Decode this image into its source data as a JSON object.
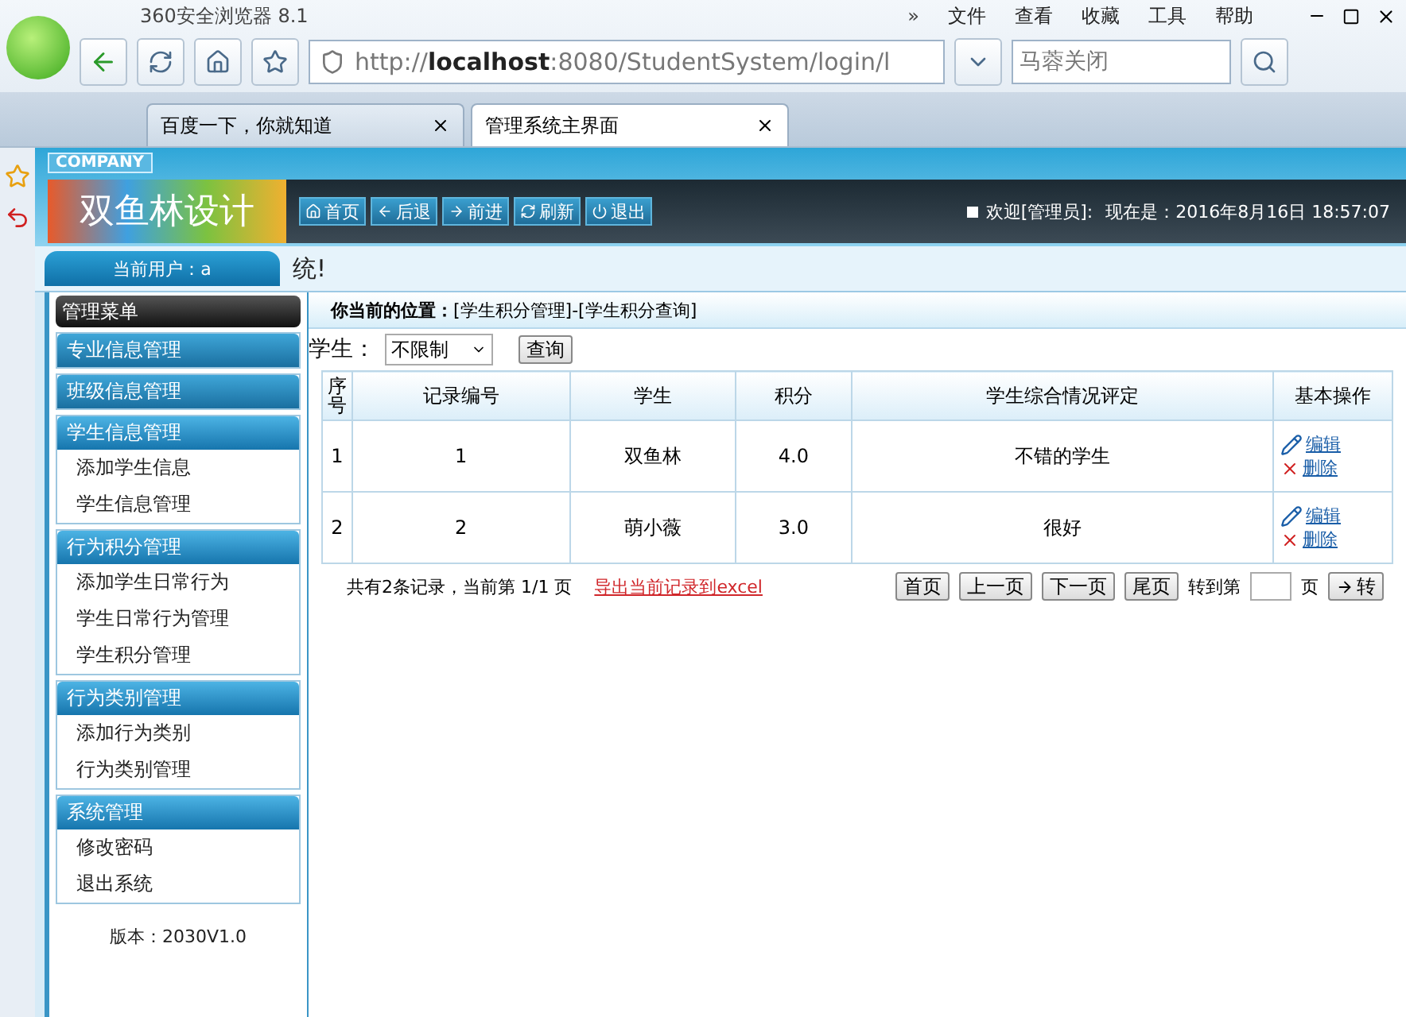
{
  "browser": {
    "title": "360安全浏览器 8.1",
    "more": "»",
    "menu": [
      "文件",
      "查看",
      "收藏",
      "工具",
      "帮助"
    ],
    "address": "http://**localhost**:8080/StudentSystem/login/l",
    "search": "马蓉关闭",
    "tabs": [
      {
        "label": "百度一下，你就知道",
        "selected": false
      },
      {
        "label": "管理系统主界面",
        "selected": true
      }
    ]
  },
  "header": {
    "company": "COMPANY",
    "logo": "双鱼林设计",
    "nav": [
      "首页",
      "后退",
      "前进",
      "刷新",
      "退出"
    ],
    "welcome": "欢迎[管理员]:",
    "time": "现在是：2016年8月16日 18:57:07"
  },
  "user_bar": {
    "current_user": "当前用户：a",
    "marquee": "统!"
  },
  "menu": {
    "title": "管理菜单",
    "groups": [
      {
        "label": "专业信息管理",
        "expanded": false
      },
      {
        "label": "班级信息管理",
        "expanded": false
      },
      {
        "label": "学生信息管理",
        "expanded": true,
        "items": [
          "添加学生信息",
          "学生信息管理"
        ]
      },
      {
        "label": "行为积分管理",
        "expanded": true,
        "items": [
          "添加学生日常行为",
          "学生日常行为管理",
          "学生积分管理"
        ]
      },
      {
        "label": "行为类别管理",
        "expanded": true,
        "items": [
          "添加行为类别",
          "行为类别管理"
        ]
      },
      {
        "label": "系统管理",
        "expanded": true,
        "items": [
          "修改密码",
          "退出系统"
        ]
      }
    ],
    "version": "版本：2030V1.0"
  },
  "main": {
    "breadcrumb": "**你当前的位置：**[学生积分管理]-[学生积分查询]",
    "filter_label": "学生：",
    "filter_value": "不限制",
    "query": "查询",
    "table": {
      "columns": [
        "序号",
        "记录编号",
        "学生",
        "积分",
        "学生综合情况评定",
        "基本操作"
      ],
      "rows": [
        {
          "cells": [
            "1",
            "1",
            "双鱼林",
            "4.0",
            "不错的学生"
          ],
          "actions": [
            "编辑",
            "删除"
          ]
        },
        {
          "cells": [
            "2",
            "2",
            "萌小薇",
            "3.0",
            "很好"
          ],
          "actions": [
            "编辑",
            "删除"
          ]
        }
      ]
    },
    "footer": {
      "summary": "共有2条记录，当前第 1/1 页",
      "export": "导出当前记录到excel",
      "pager": [
        "首页",
        "上一页",
        "下一页",
        "尾页"
      ],
      "goto": "转到第",
      "page": "页",
      "go": "转"
    }
  }
}
